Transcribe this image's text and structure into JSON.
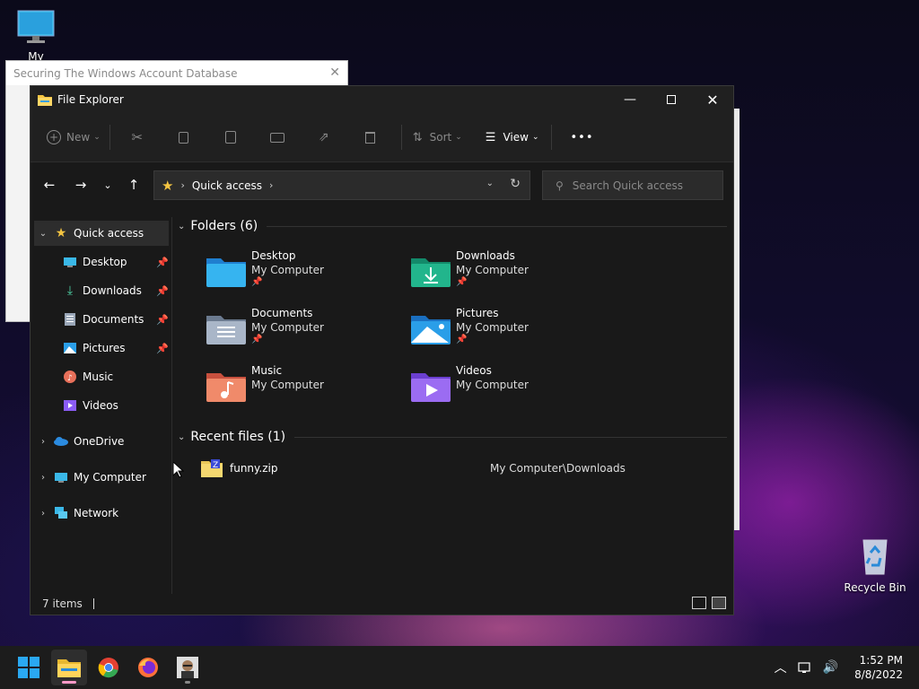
{
  "desktop": {
    "my_computer_label": "My Computer",
    "recycle_bin_label": "Recycle Bin"
  },
  "background_window": {
    "title": "Securing The Windows Account Database"
  },
  "explorer": {
    "title": "File Explorer",
    "toolbar": {
      "new_label": "New",
      "sort_label": "Sort",
      "view_label": "View",
      "more_label": "•••"
    },
    "address": {
      "location": "Quick access"
    },
    "search": {
      "placeholder": "Search Quick access"
    },
    "sidebar": {
      "quick_access": "Quick access",
      "pinned": [
        {
          "label": "Desktop",
          "icon": "desktop-icon"
        },
        {
          "label": "Downloads",
          "icon": "downloads-icon"
        },
        {
          "label": "Documents",
          "icon": "documents-icon"
        },
        {
          "label": "Pictures",
          "icon": "pictures-icon"
        },
        {
          "label": "Music",
          "icon": "music-icon"
        },
        {
          "label": "Videos",
          "icon": "videos-icon"
        }
      ],
      "onedrive": "OneDrive",
      "my_computer": "My Computer",
      "network": "Network"
    },
    "folders_header": "Folders (6)",
    "folders": [
      {
        "name": "Desktop",
        "location": "My Computer",
        "pinned": true
      },
      {
        "name": "Downloads",
        "location": "My Computer",
        "pinned": true
      },
      {
        "name": "Documents",
        "location": "My Computer",
        "pinned": true
      },
      {
        "name": "Pictures",
        "location": "My Computer",
        "pinned": true
      },
      {
        "name": "Music",
        "location": "My Computer",
        "pinned": false
      },
      {
        "name": "Videos",
        "location": "My Computer",
        "pinned": false
      }
    ],
    "recent_header": "Recent files (1)",
    "recent_files": [
      {
        "name": "funny.zip",
        "path": "My Computer\\Downloads"
      }
    ],
    "status": "7 items"
  },
  "taskbar": {
    "time": "1:52 PM",
    "date": "8/8/2022"
  },
  "colors": {
    "accent": "#ff99c8",
    "window_bg": "#191919",
    "titlebar_bg": "#202020"
  }
}
